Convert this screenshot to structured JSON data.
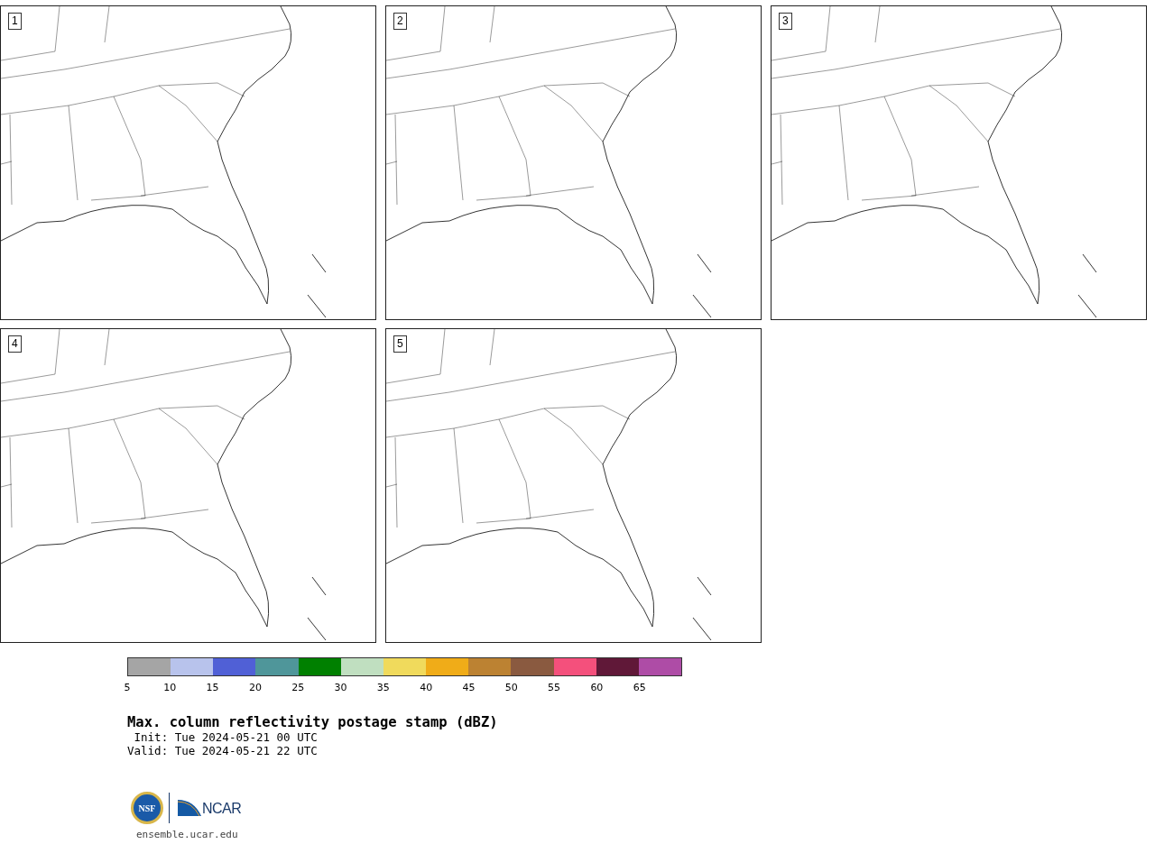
{
  "panels": [
    {
      "label": "1"
    },
    {
      "label": "2"
    },
    {
      "label": "3"
    },
    {
      "label": "4"
    },
    {
      "label": "5"
    }
  ],
  "colorbar": {
    "segments": [
      {
        "color": "#a5a5a5"
      },
      {
        "color": "#b8c3ec"
      },
      {
        "color": "#5060d6"
      },
      {
        "color": "#4f969a"
      },
      {
        "color": "#008000"
      },
      {
        "color": "#c0dfc0"
      },
      {
        "color": "#f0da5c"
      },
      {
        "color": "#f0ac18"
      },
      {
        "color": "#bc8232"
      },
      {
        "color": "#8a5a40"
      },
      {
        "color": "#f4507c"
      },
      {
        "color": "#601838"
      },
      {
        "color": "#ae4ca6"
      }
    ],
    "ticks": [
      "5",
      "10",
      "15",
      "20",
      "25",
      "30",
      "35",
      "40",
      "45",
      "50",
      "55",
      "60",
      "65"
    ]
  },
  "title": "Max. column reflectivity postage stamp (dBZ)",
  "init": " Init: Tue 2024-05-21 00 UTC",
  "valid": "Valid: Tue 2024-05-21 22 UTC",
  "logos": {
    "nsf": "NSF",
    "ncar": "NCAR"
  },
  "footer": "ensemble.ucar.edu"
}
